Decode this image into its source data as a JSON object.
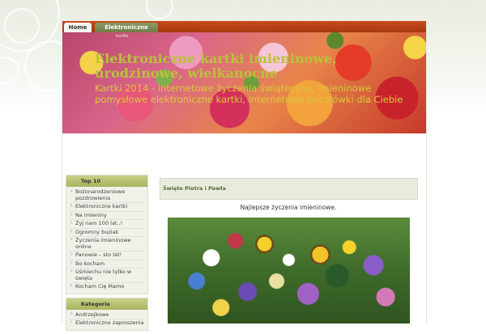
{
  "nav": {
    "tabs": [
      {
        "label": "Home"
      },
      {
        "label": "Elektroniczne"
      }
    ],
    "tab_caption": "kartki"
  },
  "header": {
    "title": "Elektroniczne kartki imieninowe, urodzinowe, wielkanocne",
    "description": "Kartki 2014 - internetowe życzenia świąteczne, imieninowe pomysłowe elektroniczne kartki, internetowe pocztówki dla Ciebie"
  },
  "sidebar": {
    "top10": {
      "title": "Top 10",
      "items": [
        "Bożonarodzeniowe pozdrowienia",
        "Elektroniczne kartki",
        "Na imieniny",
        "Żyj nam 100 lat..!",
        "Ogromny buziak",
        "Życzenia imieninowe online",
        "Panowie – sto lat!",
        "Bo kocham",
        "Uśmiechu nie tylko w święta",
        "Kocham Cię Mamo"
      ]
    },
    "categories": {
      "title": "Kategorie",
      "items": [
        "Andrzejkowe",
        "Elektroniczne zaproszenia"
      ]
    }
  },
  "post": {
    "title": "Święto Piotra i Pawła",
    "text": "Najlepsze życzenia imieninowe."
  },
  "colors": {
    "nav_bar": "#b23e12",
    "accent_olive": "#a9b35e",
    "title_text": "#b9c23a"
  }
}
